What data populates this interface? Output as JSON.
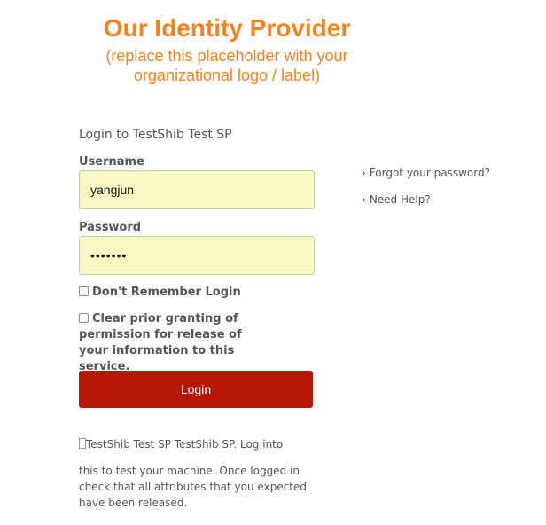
{
  "logo": {
    "title": "Our Identity Provider",
    "subtitle_line1": "(replace this placeholder with your",
    "subtitle_line2": "organizational logo / label)"
  },
  "form": {
    "heading": "Login to TestShib Test SP",
    "username_label": "Username",
    "username_value": "yangjun",
    "password_label": "Password",
    "password_mask": "•••••••",
    "dont_remember_label": "Don't Remember Login",
    "clear_granting_label": "Clear prior granting of permission for release of your information to this service.",
    "login_button": "Login"
  },
  "side_links": {
    "forgot_password": "Forgot your password?",
    "need_help": "Need Help?"
  },
  "service": {
    "image_alt": "TestShib Test SP",
    "line": "TestShib SP. Log into",
    "description": "this to test your machine. Once logged in check that all attributes that you expected have been released."
  },
  "colors": {
    "brand_orange": "#f58220",
    "login_red": "#b51605",
    "input_yellow": "#fafac7"
  }
}
